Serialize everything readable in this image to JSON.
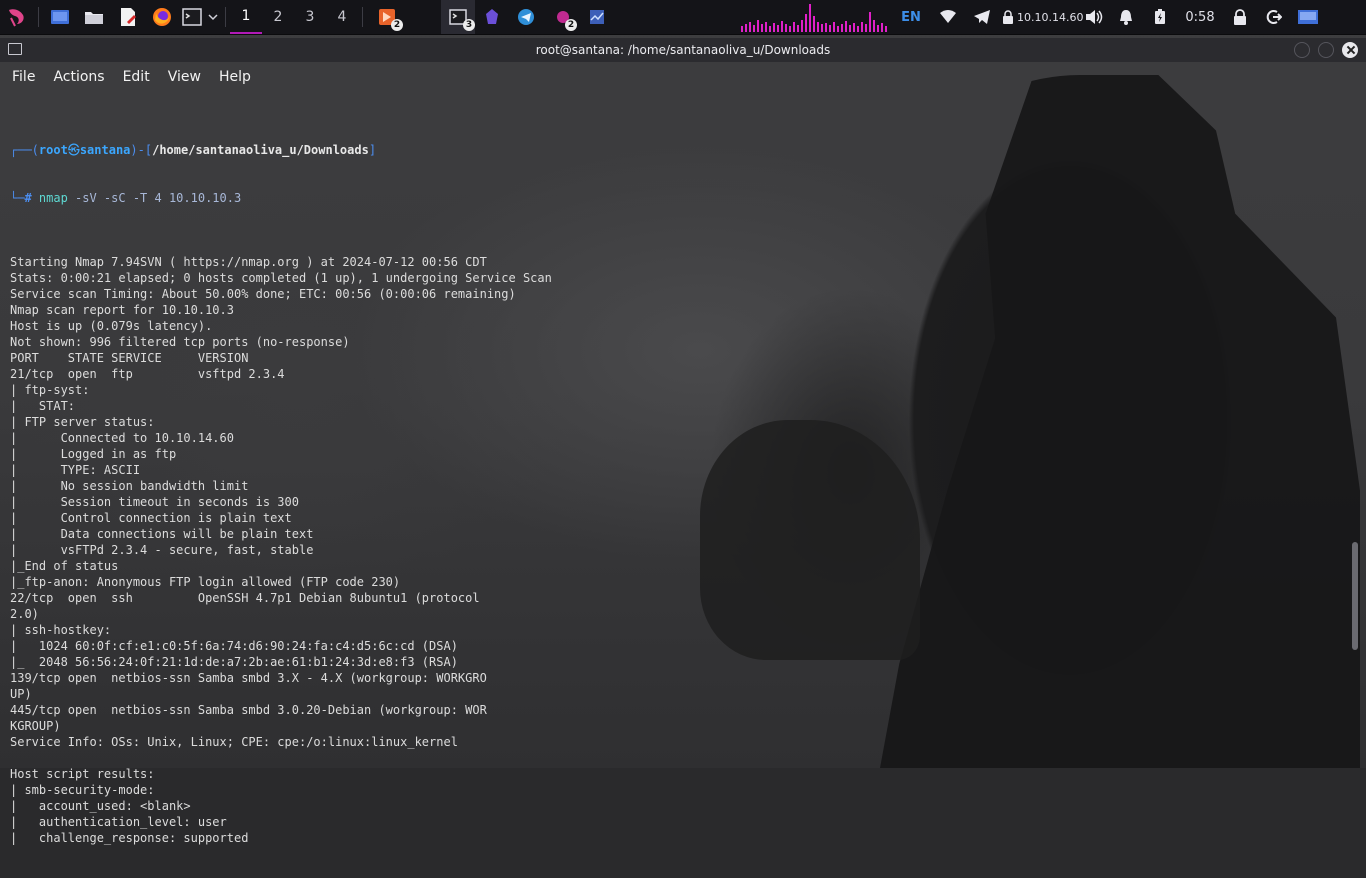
{
  "panel": {
    "workspaces": [
      "1",
      "2",
      "3",
      "4"
    ],
    "active_workspace": "1",
    "badges": {
      "task1": "2",
      "task2": "3",
      "task3": "2"
    },
    "language": "EN",
    "ip": "10.10.14.60",
    "clock": "0:58",
    "accent_color": "#b21ab8"
  },
  "window": {
    "title": "root@santana: /home/santanaoliva_u/Downloads"
  },
  "menu": [
    "File",
    "Actions",
    "Edit",
    "View",
    "Help"
  ],
  "prompt": {
    "frame_top": "┌──(",
    "user": "root",
    "at": "㉿",
    "host": "santana",
    "mid": ")-[",
    "path": "/home/santanaoliva_u/Downloads",
    "end": "]",
    "frame_bottom": "└─",
    "hash": "# ",
    "command": "nmap",
    "args": " -sV -sC -T 4 10.10.10.3"
  },
  "output": [
    "",
    "Starting Nmap 7.94SVN ( https://nmap.org ) at 2024-07-12 00:56 CDT",
    "Stats: 0:00:21 elapsed; 0 hosts completed (1 up), 1 undergoing Service Scan",
    "Service scan Timing: About 50.00% done; ETC: 00:56 (0:00:06 remaining)",
    "Nmap scan report for 10.10.10.3",
    "Host is up (0.079s latency).",
    "Not shown: 996 filtered tcp ports (no-response)",
    "PORT    STATE SERVICE     VERSION",
    "21/tcp  open  ftp         vsftpd 2.3.4",
    "| ftp-syst: ",
    "|   STAT: ",
    "| FTP server status:",
    "|      Connected to 10.10.14.60",
    "|      Logged in as ftp",
    "|      TYPE: ASCII",
    "|      No session bandwidth limit",
    "|      Session timeout in seconds is 300",
    "|      Control connection is plain text",
    "|      Data connections will be plain text",
    "|      vsFTPd 2.3.4 - secure, fast, stable",
    "|_End of status",
    "|_ftp-anon: Anonymous FTP login allowed (FTP code 230)",
    "22/tcp  open  ssh         OpenSSH 4.7p1 Debian 8ubuntu1 (protocol ",
    "2.0)",
    "| ssh-hostkey: ",
    "|   1024 60:0f:cf:e1:c0:5f:6a:74:d6:90:24:fa:c4:d5:6c:cd (DSA)",
    "|_  2048 56:56:24:0f:21:1d:de:a7:2b:ae:61:b1:24:3d:e8:f3 (RSA)",
    "139/tcp open  netbios-ssn Samba smbd 3.X - 4.X (workgroup: WORKGRO",
    "UP)",
    "445/tcp open  netbios-ssn Samba smbd 3.0.20-Debian (workgroup: WOR",
    "KGROUP)",
    "Service Info: OSs: Unix, Linux; CPE: cpe:/o:linux:linux_kernel",
    "",
    "Host script results:",
    "| smb-security-mode: ",
    "|   account_used: <blank>",
    "|   authentication_level: user",
    "|   challenge_response: supported"
  ]
}
